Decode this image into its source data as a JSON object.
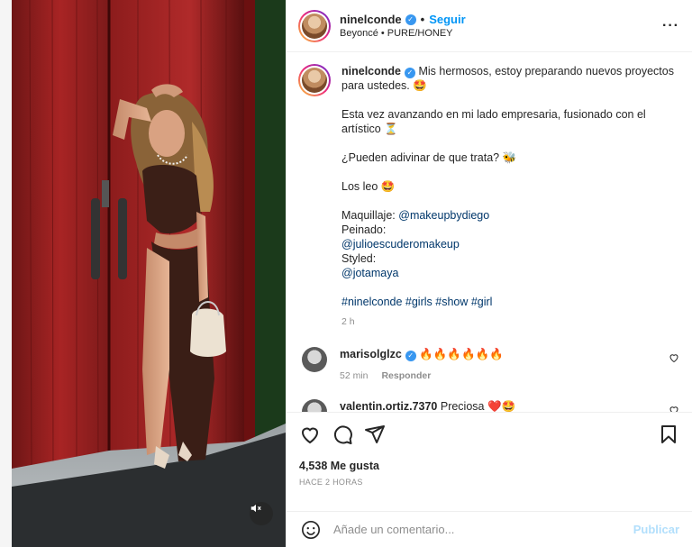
{
  "header": {
    "username": "ninelconde",
    "follow_label": "Seguir",
    "audio": "Beyoncé • PURE/HONEY"
  },
  "caption": {
    "username": "ninelconde",
    "line1": "Mis hermosos, estoy preparando nuevos proyectos para ustedes. 🤩",
    "line2": "Esta vez avanzando en mi lado empresaria, fusionado con el artístico ⏳",
    "line3": "¿Pueden adivinar de que trata? 🐝",
    "line4": "Los leo 🤩",
    "credit1_label": "Maquillaje:",
    "credit1_link": "@makeupbydiego",
    "credit2_label": "Peinado:",
    "credit2_link": "@julioescuderomakeup",
    "credit3_label": "Styled:",
    "credit3_link": "@jotamaya",
    "hashtags": "#ninelconde #girls #show #girl",
    "time": "2 h"
  },
  "comments": [
    {
      "username": "marisolglzc",
      "text": "🔥🔥🔥🔥🔥🔥",
      "time": "52 min",
      "reply_label": "Responder"
    },
    {
      "username": "valentin.ortiz.7370",
      "text": "Preciosa ❤️🤩"
    }
  ],
  "actions": {
    "likes": "4,538 Me gusta",
    "timestamp": "HACE 2 HORAS"
  },
  "add_comment": {
    "placeholder": "Añade un comentario...",
    "publish_label": "Publicar"
  },
  "colors": {
    "accent": "#0095f6",
    "publish_disabled": "#b2dffc",
    "muted": "#8e8e8e"
  }
}
